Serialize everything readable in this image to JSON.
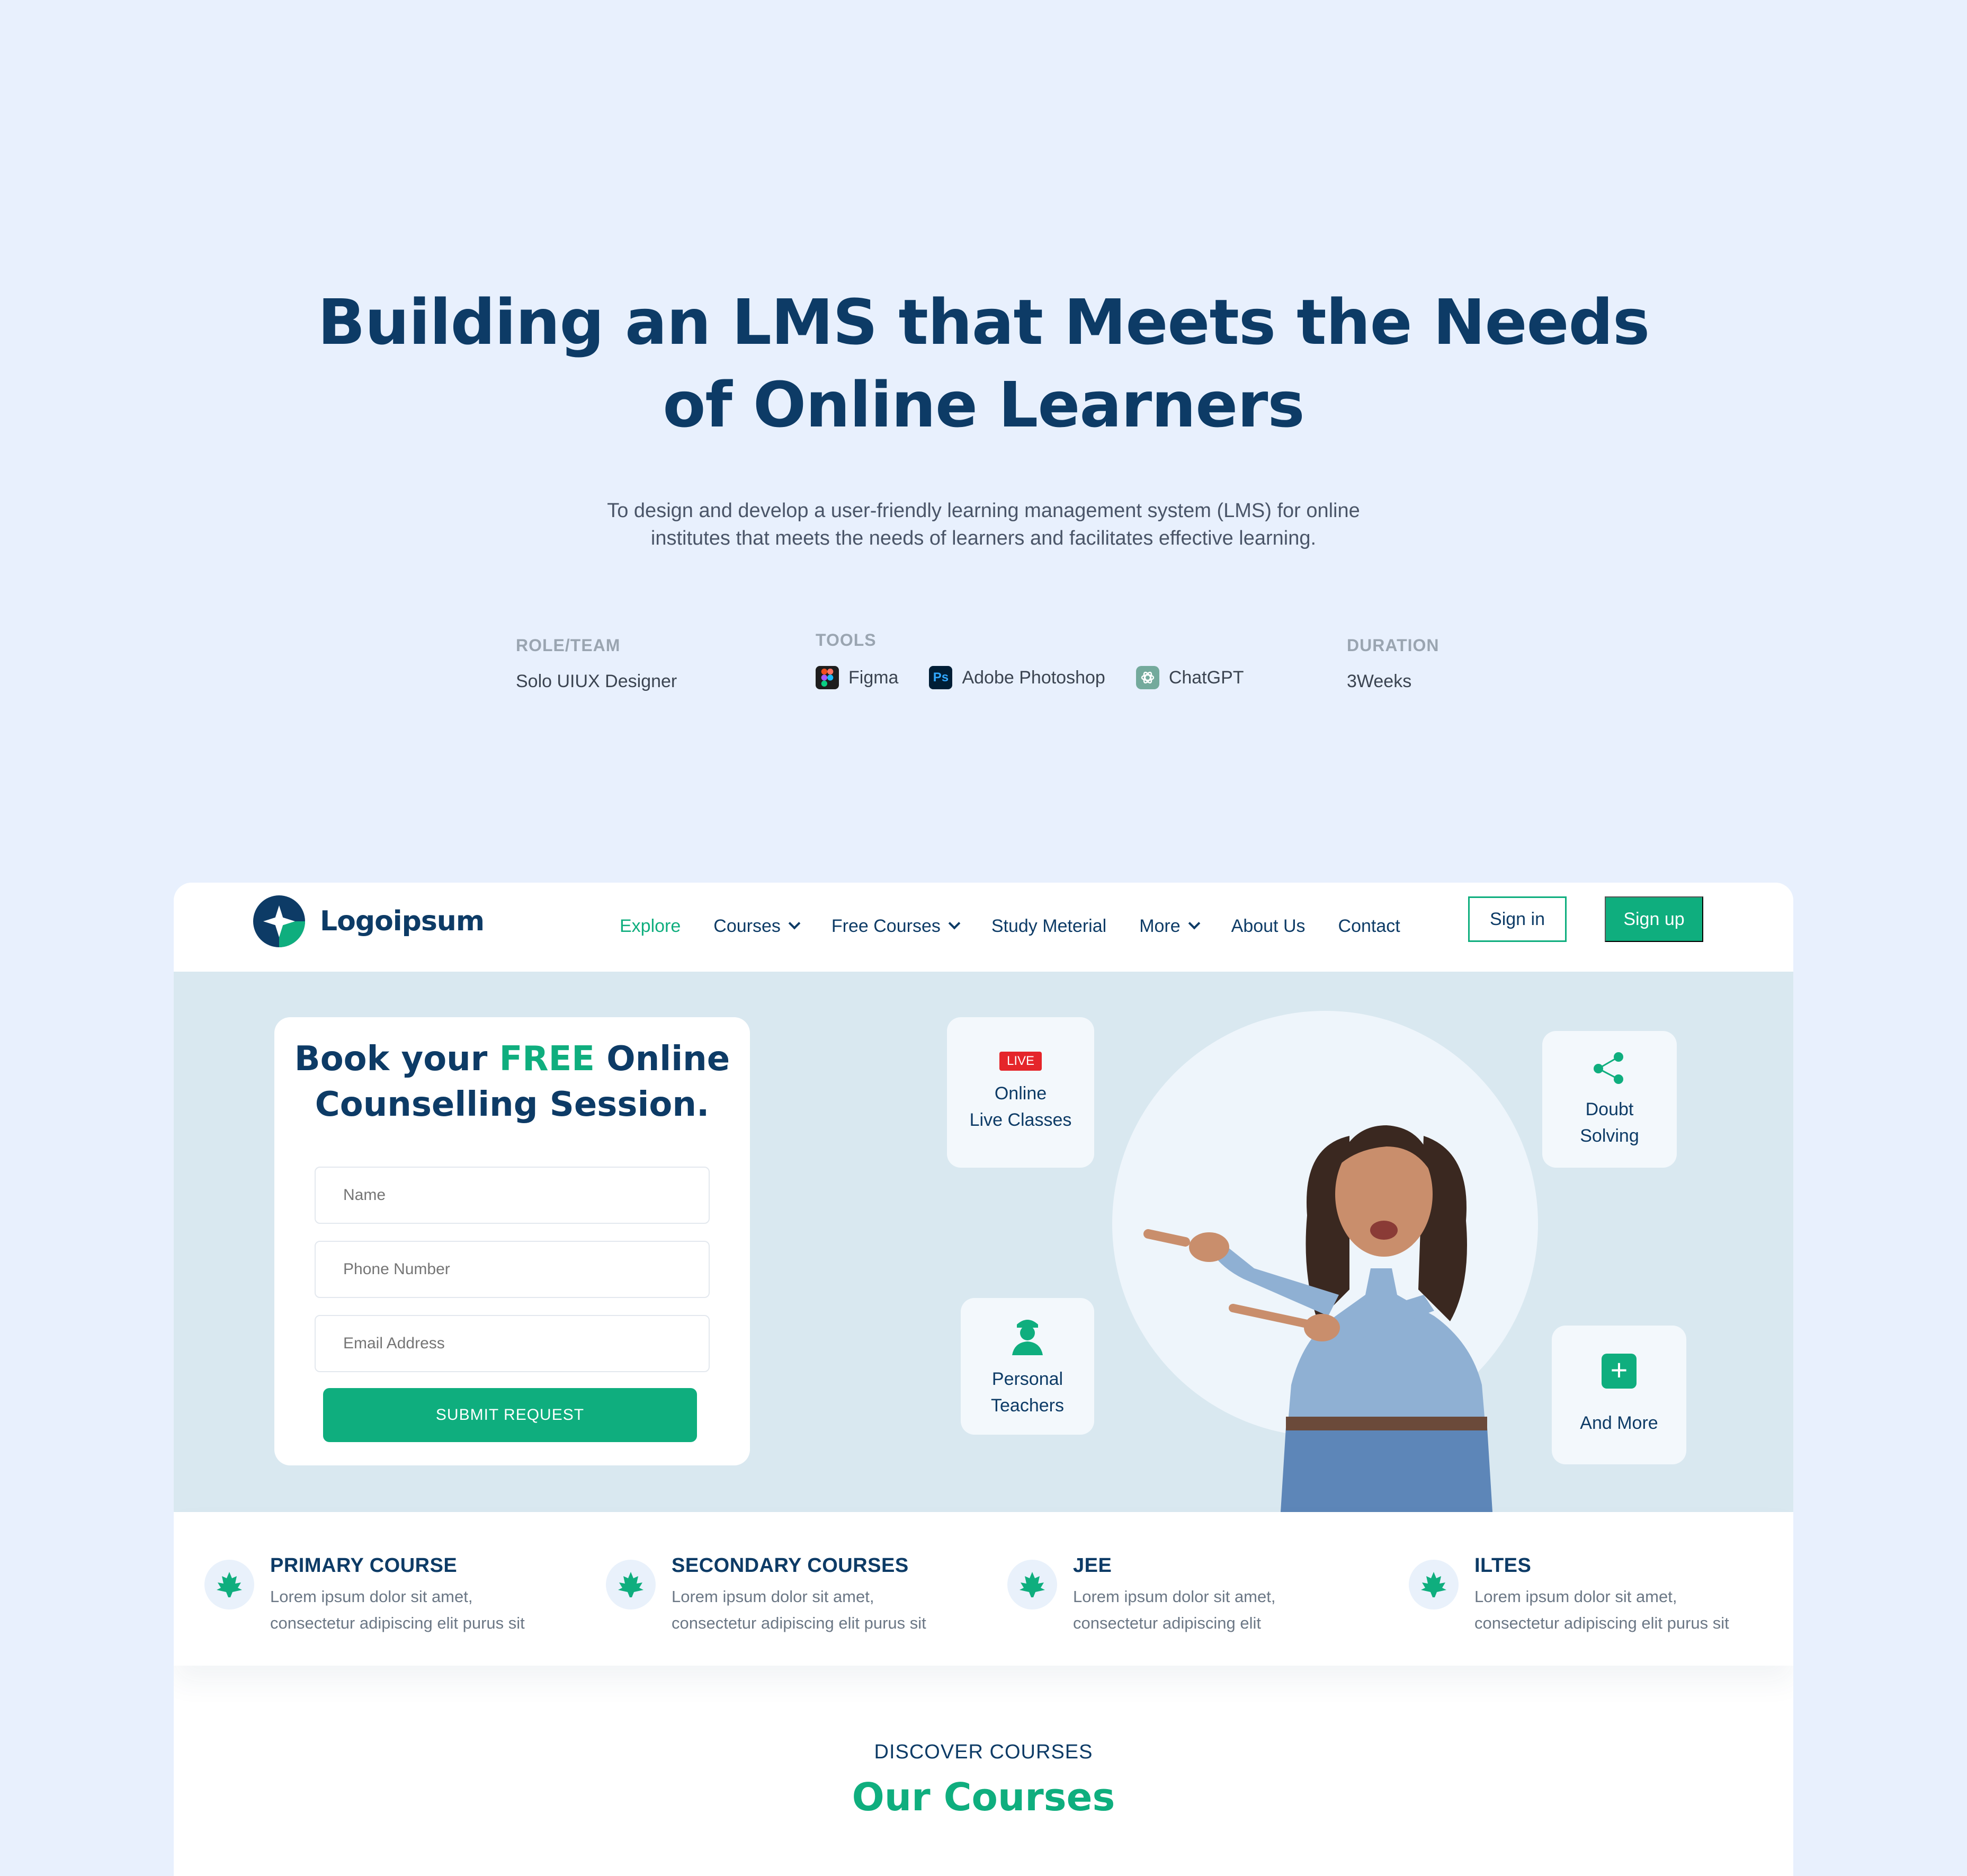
{
  "hero": {
    "title_line1": "Building an LMS that Meets the Needs",
    "title_line2": "of Online Learners",
    "subtitle_line1": "To design and develop a user-friendly learning management system (LMS) for online",
    "subtitle_line2": "institutes that meets the needs of learners and facilitates effective learning."
  },
  "meta": {
    "role_label": "ROLE/TEAM",
    "role_value": "Solo UIUX Designer",
    "tools_label": "TOOLS",
    "tools": [
      {
        "name": "Figma",
        "icon": "figma-icon"
      },
      {
        "name": "Adobe Photoshop",
        "icon": "photoshop-icon",
        "glyph": "Ps"
      },
      {
        "name": "ChatGPT",
        "icon": "chatgpt-icon"
      }
    ],
    "duration_label": "DURATION",
    "duration_value": "3Weeks"
  },
  "site": {
    "logo_text": "Logoipsum",
    "nav": [
      {
        "label": "Explore",
        "active": true
      },
      {
        "label": "Courses",
        "dropdown": true
      },
      {
        "label": "Free Courses",
        "dropdown": true
      },
      {
        "label": "Study Meterial"
      },
      {
        "label": "More",
        "dropdown": true
      },
      {
        "label": "About Us"
      },
      {
        "label": "Contact"
      }
    ],
    "signin_label": "Sign in",
    "signup_label": "Sign up",
    "form": {
      "title_part1": "Book your ",
      "title_highlight": "FREE",
      "title_part2": " Online",
      "title_line2": "Counselling Session.",
      "name_placeholder": "Name",
      "phone_placeholder": "Phone Number",
      "email_placeholder": "Email Address",
      "submit_label": "SUBMIT REQUEST"
    },
    "features": {
      "live_badge": "LIVE",
      "live_line1": "Online",
      "live_line2": "Live Classes",
      "doubt_line1": "Doubt",
      "doubt_line2": "Solving",
      "teachers_line1": "Personal",
      "teachers_line2": "Teachers",
      "more_label": "And More"
    },
    "courses": [
      {
        "title": "PRIMARY COURSE",
        "desc1": "Lorem ipsum dolor sit amet,",
        "desc2": "consectetur adipiscing elit purus sit"
      },
      {
        "title": "SECONDARY COURSES",
        "desc1": "Lorem ipsum dolor sit amet,",
        "desc2": "consectetur adipiscing elit purus sit"
      },
      {
        "title": "JEE",
        "desc1": "Lorem ipsum dolor sit amet,",
        "desc2": "consectetur adipiscing elit"
      },
      {
        "title": "ILTES",
        "desc1": "Lorem ipsum dolor sit amet,",
        "desc2": "consectetur adipiscing elit purus sit"
      }
    ],
    "discover_label": "DISCOVER COURSES",
    "our_courses_title": "Our Courses"
  },
  "colors": {
    "background": "#e8f0fd",
    "navy": "#0d3b66",
    "green": "#0fae7e",
    "banner": "#d9e8f0",
    "live_red": "#e5252a"
  }
}
